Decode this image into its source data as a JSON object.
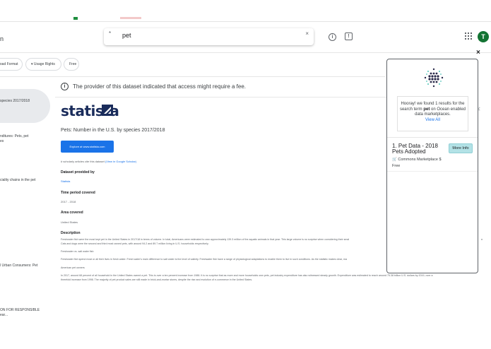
{
  "header": {
    "left_cut_text": "n",
    "search_value": "pet",
    "search_icon": "search-icon",
    "clear_icon": "close-icon",
    "info_icon": "info-icon",
    "feedback_icon": "feedback-icon",
    "apps_icon": "apps-grid-icon",
    "avatar_letter": "T"
  },
  "filters": {
    "download_format": "nload Format",
    "usage_rights": "▾ Usage Rights",
    "free": "Free"
  },
  "sidebar": {
    "items": [
      {
        "line1": "species 2017/2018",
        "line2": ""
      },
      {
        "line1": "nditures: Pets, pet",
        "line2": "es"
      },
      {
        "line1": "ciality chains in the pet",
        "line2": ""
      },
      {
        "line1": "l Urban Consumers: Pet",
        "line2": ""
      },
      {
        "line1": "ON FOR RESPONSIBLE",
        "line2": "ear..."
      }
    ]
  },
  "main": {
    "fee_notice": "The provider of this dataset indicated that access might require a fee.",
    "logo_text": "statista",
    "dataset_title": "Pets: Number in the U.S. by species 2017/2018",
    "explore_button": "Explore at www.statista.com",
    "scholar_prefix": "# scholarly articles cite this dataset",
    "scholar_link": "(View in Google Scholar)",
    "provided_by_label": "Dataset provided by",
    "provided_by_value": "Statista",
    "time_label": "Time period covered",
    "time_value": "2017 - 2018",
    "area_label": "Area covered",
    "area_value": "United States",
    "description_label": "Description",
    "description_lines": [
      "Freshwater fish were the most kept pet in the United States in 2017/18 in terms of volume. In total, Americans were estimated to own approximately 139.3 million of the aquatic animals in that year. This large volume is no surprise when considering their smal",
      "Cats and dogs were the second and third most owned pets, with around 94.2 and 89.7 million living in U.S. households respectively.",
      "Freshwater vs. salt water fish",
      "Freshwater fish spend most or all their lives in fresh water. Fresh water's main difference to salt water is the level of salinity. Freshwater fish have a range of physiological adaptations to enable them to live in such conditions. As the statistic makes clear, ma",
      "American pet owners",
      "In 2017, around 68 percent of all household in the United States owned a pet. This is over a ten percent increase from 1988. It is no surprise that as more and more households own pets, pet industry expenditure has also witnessed steady growth. Expenditure was estimated to reach around 75.38 billion U.S. dollars by 2019, over a",
      "threefold increase from 1998. The majority of pet product sales are still made in brick-and-mortar stores, despite the rise and evolution of e-commerce in the United States."
    ],
    "right_edge_text": "n"
  },
  "panel": {
    "close": "×",
    "hooray_pre": "Hooray! we found 1 results for the search term ",
    "hooray_term": "pet",
    "hooray_post": " on Ocean enabled data marketplaces.",
    "view_all": "View All",
    "result_title": "1. Pet Data - 2018 Pets Adopted",
    "more_info": "More Info",
    "result_market": "🛒 Commons Marketplace   $",
    "result_price": "Free"
  },
  "colors": {
    "accent_blue": "#1a73e8",
    "avatar_green": "#137333",
    "statista_navy": "#1a2c5b",
    "more_info_bg": "#b3e2e6"
  }
}
